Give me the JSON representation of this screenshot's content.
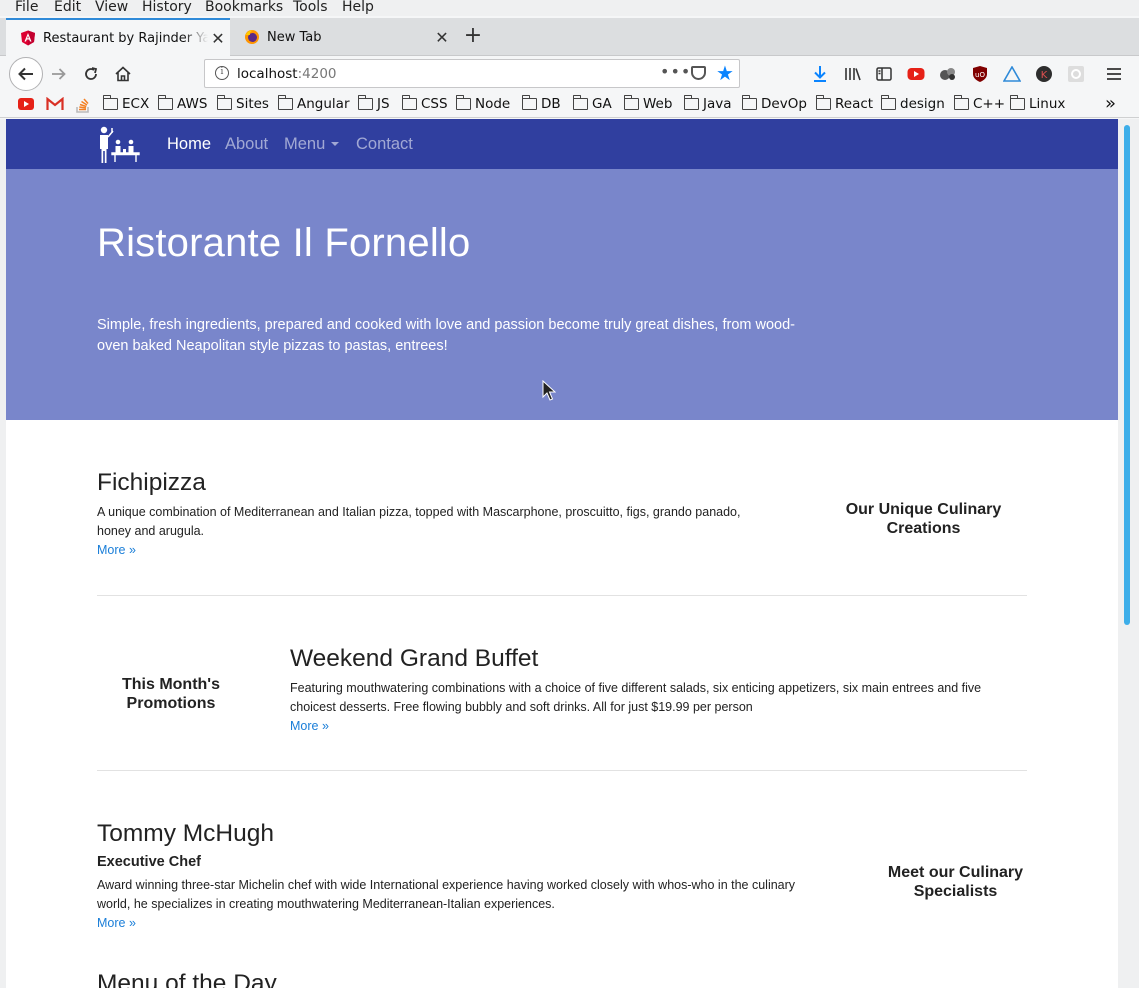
{
  "menubar": [
    "File",
    "Edit",
    "View",
    "History",
    "Bookmarks",
    "Tools",
    "Help"
  ],
  "tabs": [
    {
      "title": "Restaurant by Rajinder Yadav",
      "icon": "angular-icon",
      "active": true
    },
    {
      "title": "New Tab",
      "icon": "firefox-icon",
      "active": false
    }
  ],
  "url": {
    "host": "localhost",
    "port": ":4200"
  },
  "bookmarks": [
    "ECX",
    "AWS",
    "Sites",
    "Angular",
    "JS",
    "CSS",
    "Node",
    "DB",
    "GA",
    "Web",
    "Java",
    "DevOp",
    "React",
    "design",
    "C++",
    "Linux"
  ],
  "site": {
    "nav": {
      "home": "Home",
      "about": "About",
      "menu": "Menu",
      "contact": "Contact"
    },
    "hero": {
      "title": "Ristorante Il Fornello",
      "text": "Simple, fresh ingredients, prepared and cooked with love and passion become truly great dishes, from wood-oven baked Neapolitan style pizzas to pastas, entrees!"
    },
    "dish": {
      "title": "Fichipizza",
      "desc": "A unique combination of Mediterranean and Italian pizza, topped with Mascarphone, proscuitto, figs, grando panado, honey and arugula.",
      "more": "More »",
      "side": "Our Unique Culinary Creations"
    },
    "promo": {
      "title": "Weekend Grand Buffet",
      "desc": "Featuring mouthwatering combinations with a choice of five different salads, six enticing appetizers, six main entrees and five choicest desserts. Free flowing bubbly and soft drinks. All for just $19.99 per person",
      "more": "More »",
      "side": "This Month's Promotions"
    },
    "chef": {
      "title": "Tommy McHugh",
      "subtitle": "Executive Chef",
      "desc": "Award winning three-star Michelin chef with wide International experience having worked closely with whos-who in the culinary world, he specializes in creating mouthwatering Mediterranean-Italian experiences.",
      "more": "More »",
      "side": "Meet our Culinary Specialists"
    },
    "next_heading": "Menu of the Day"
  },
  "colors": {
    "navbar": "#303f9f",
    "hero": "#7986cb",
    "link": "#1a7ed8"
  }
}
